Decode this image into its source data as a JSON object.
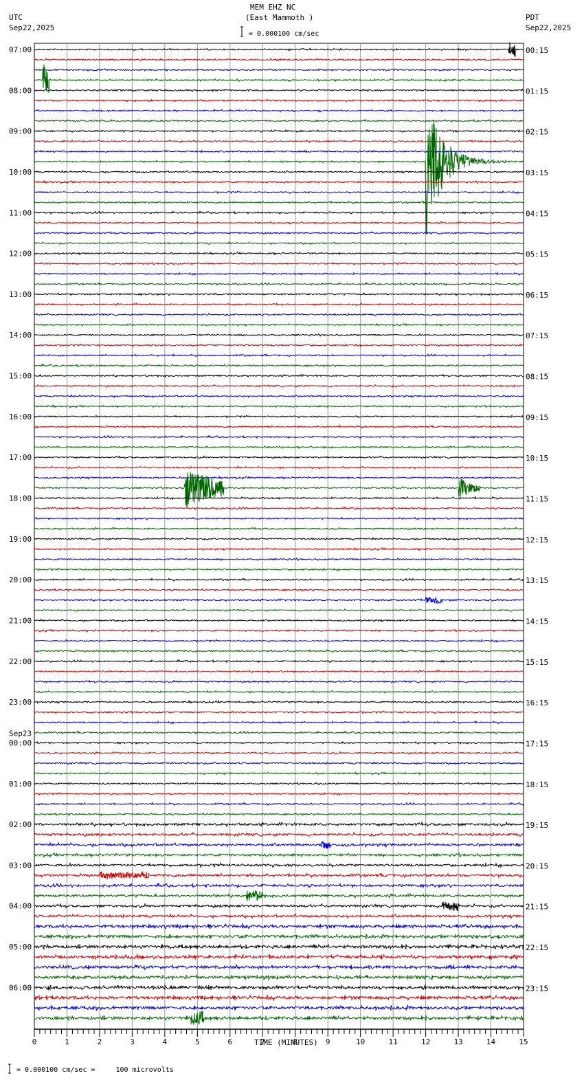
{
  "header": {
    "station": "MEM EHZ NC",
    "location": "(East Mammoth )",
    "scale_label": "= 0.000100 cm/sec",
    "left_tz": "UTC",
    "left_date": "Sep22,2025",
    "right_tz": "PDT",
    "right_date": "Sep22,2025"
  },
  "footer": {
    "scale_note": "= 0.000100 cm/sec =     100 microvolts"
  },
  "chart_data": {
    "type": "line",
    "title": "MEM EHZ NC (East Mammoth )",
    "xlabel": "TIME (MINUTES)",
    "xlim": [
      0,
      15
    ],
    "x_ticks": [
      "0",
      "1",
      "2",
      "3",
      "4",
      "5",
      "6",
      "7",
      "8",
      "9",
      "10",
      "11",
      "12",
      "13",
      "14",
      "15"
    ],
    "trace_count": 96,
    "trace_minutes": 15,
    "trace_colors": [
      "#000000",
      "#cc0000",
      "#0000cc",
      "#006600"
    ],
    "left_labels": [
      "07:00",
      "08:00",
      "09:00",
      "10:00",
      "11:00",
      "12:00",
      "13:00",
      "14:00",
      "15:00",
      "16:00",
      "17:00",
      "18:00",
      "19:00",
      "20:00",
      "21:00",
      "22:00",
      "23:00",
      "00:00",
      "01:00",
      "02:00",
      "03:00",
      "04:00",
      "05:00",
      "06:00"
    ],
    "left_date_change": {
      "label": "Sep23",
      "before_label_index": 17
    },
    "right_labels": [
      "00:15",
      "01:15",
      "02:15",
      "03:15",
      "04:15",
      "05:15",
      "06:15",
      "07:15",
      "08:15",
      "09:15",
      "10:15",
      "11:15",
      "12:15",
      "13:15",
      "14:15",
      "15:15",
      "16:15",
      "17:15",
      "18:15",
      "19:15",
      "20:15",
      "21:15",
      "22:15",
      "23:15"
    ],
    "events": [
      {
        "trace": 3,
        "start": 0.25,
        "end": 0.45,
        "amp": 25,
        "note": "spike"
      },
      {
        "trace": 0,
        "start": 14.55,
        "end": 14.75,
        "amp": 10
      },
      {
        "trace": 11,
        "start": 12.0,
        "end": 15.0,
        "amp": 120,
        "decay": 2.2
      },
      {
        "trace": 43,
        "start": 4.6,
        "end": 5.8,
        "amp": 30,
        "decay": 0.8
      },
      {
        "trace": 43,
        "start": 13.0,
        "end": 13.7,
        "amp": 15,
        "decay": 2
      },
      {
        "trace": 54,
        "start": 12.0,
        "end": 12.5,
        "amp": 4
      },
      {
        "trace": 78,
        "start": 8.8,
        "end": 9.1,
        "amp": 4
      },
      {
        "trace": 81,
        "start": 2.0,
        "end": 3.5,
        "amp": 3
      },
      {
        "trace": 83,
        "start": 6.5,
        "end": 7.0,
        "amp": 6
      },
      {
        "trace": 84,
        "start": 12.5,
        "end": 13.0,
        "amp": 5
      },
      {
        "trace": 95,
        "start": 4.8,
        "end": 5.2,
        "amp": 8
      }
    ]
  }
}
